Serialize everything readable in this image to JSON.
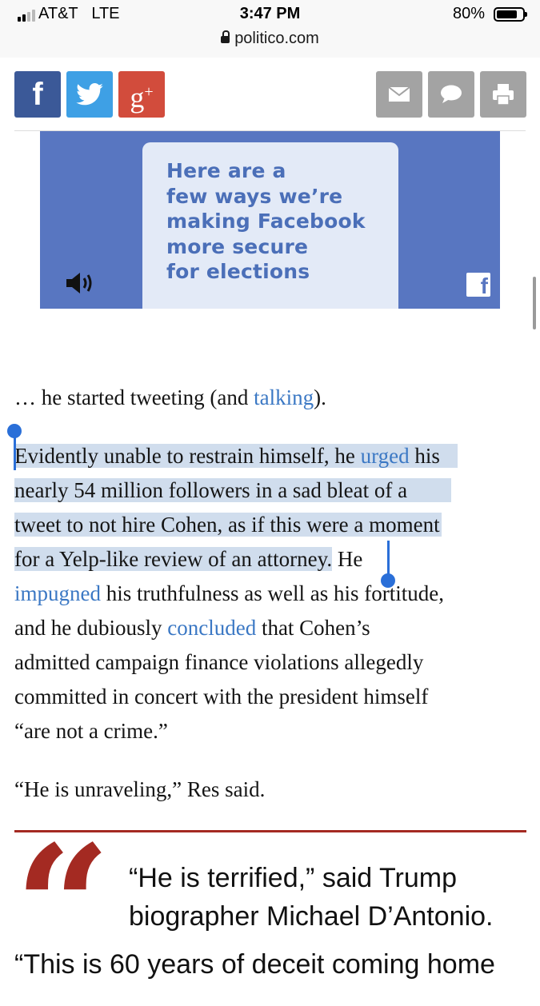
{
  "status_bar": {
    "carrier": "AT&T",
    "network": "LTE",
    "time": "3:47 PM",
    "battery_percent": "80%",
    "battery_level": 0.8,
    "signal_bars": 2
  },
  "browser": {
    "domain": "politico.com"
  },
  "share_bar": {
    "left": [
      {
        "name": "facebook",
        "icon": "facebook-icon",
        "glyph": "f",
        "color": "#3b5998"
      },
      {
        "name": "twitter",
        "icon": "twitter-icon",
        "color": "#3ea0e5"
      },
      {
        "name": "google-plus",
        "icon": "google-plus-icon",
        "glyph": "g+",
        "color": "#d24c3c"
      }
    ],
    "right": [
      {
        "name": "email",
        "icon": "mail-icon",
        "color": "#a3a3a3"
      },
      {
        "name": "comment",
        "icon": "comment-icon",
        "color": "#a3a3a3"
      },
      {
        "name": "print",
        "icon": "printer-icon",
        "color": "#a3a3a3"
      }
    ]
  },
  "ad": {
    "lines": [
      "Here are a",
      "few ways we’re",
      "making Facebook",
      "more secure",
      "for elections"
    ],
    "background": "#5876c1",
    "card_color": "#e3eaf7",
    "text_color": "#4b6fb8"
  },
  "article": {
    "p1": {
      "before": "… he started tweeting (and ",
      "link": "talking",
      "after": ")."
    },
    "p2": {
      "l1_pre": "Evidently unable to restrain himself, he ",
      "l1_link": "urged",
      "l1_post": " his",
      "l2": "nearly 54 million followers in a sad bleat of a",
      "l3": "tweet to not hire Cohen, as if this were a moment",
      "l4_hl": "for a Yelp-like review of an attorney.",
      "l4_rest": " He",
      "l5_link": "impugned",
      "l5_post": " his truthfulness as well as his fortitude,",
      "l6_pre": "and he dubiously ",
      "l6_link": "concluded",
      "l6_post": " that Cohen’s",
      "l7": "admitted campaign finance violations allegedly",
      "l8": "committed in concert with the president himself",
      "l9": "“are not a crime.”"
    },
    "p3": "“He is unraveling,” Res said.",
    "quote_mark": "“",
    "pull_quote": {
      "l1": "“He is terrified,” said Trump",
      "l2": "biographer Michael D’Antonio.",
      "l3": "“This is 60 years of deceit coming home"
    },
    "accent_color": "#a42a22",
    "link_color": "#3b78c4",
    "highlight_color": "#d0dded"
  }
}
